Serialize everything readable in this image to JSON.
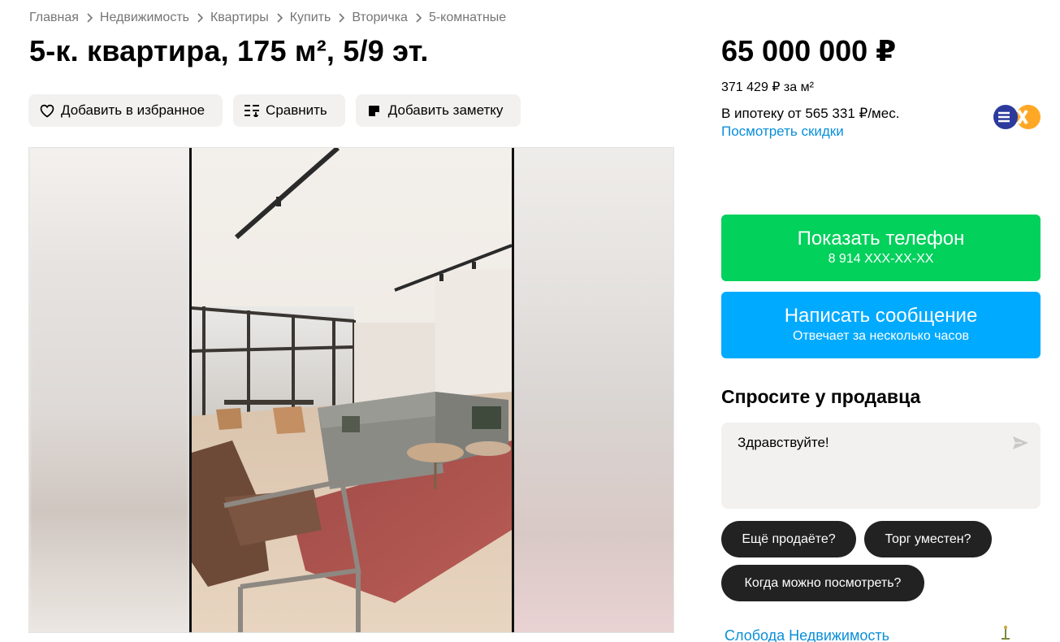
{
  "breadcrumb": [
    "Главная",
    "Недвижимость",
    "Квартиры",
    "Купить",
    "Вторичка",
    "5-комнатные"
  ],
  "title": "5-к. квартира, 175 м², 5/9 эт.",
  "actions": {
    "favorite": "Добавить в избранное",
    "compare": "Сравнить",
    "note": "Добавить заметку"
  },
  "price": {
    "total": "65 000 000 ₽",
    "per_meter": "371 429 ₽ за м²",
    "mortgage": "В ипотеку от 565 331 ₽/мес.",
    "discount_link": "Посмотреть скидки",
    "bank_logo_icon": "bank-logo-icon"
  },
  "contact": {
    "phone_label": "Показать телефон",
    "phone_number": "8 914 XXX-XX-XX",
    "message_label": "Написать сообщение",
    "message_sub": "Отвечает за несколько часов"
  },
  "ask": {
    "title": "Спросите у продавца",
    "input_value": "Здравствуйте!",
    "chips": [
      "Ещё продаёте?",
      "Торг уместен?",
      "Когда можно посмотреть?"
    ]
  },
  "seller": {
    "name": "Слобода Недвижимость"
  },
  "colors": {
    "green": "#02d15c",
    "blue": "#00aaff",
    "link": "#0a8fd8",
    "chip": "#222222"
  }
}
